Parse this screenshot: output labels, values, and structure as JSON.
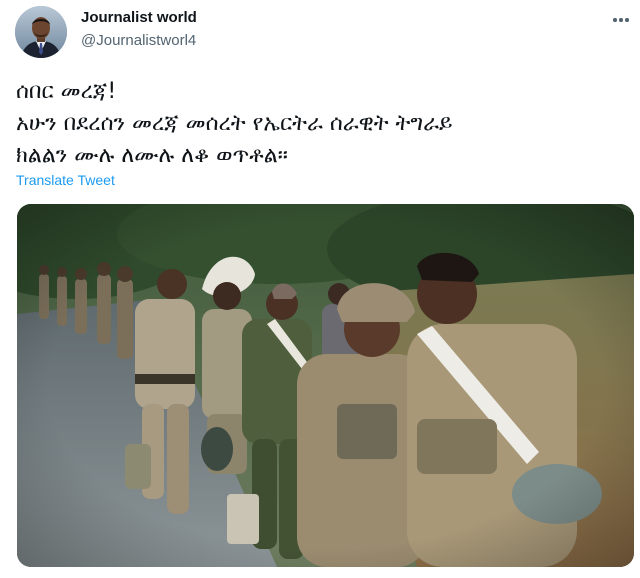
{
  "author": {
    "display_name": "Journalist world",
    "handle": "@Journalistworl4",
    "avatar_icon": "person-in-suit-avatar"
  },
  "more_menu_icon": "ellipsis-icon",
  "tweet": {
    "lines": [
      "ሰበር መረጃ!",
      "አሁን በደረሰን መረጃ መሰረት የኤርትራ ሰራዊት ትግራይ",
      "ክልልን ሙሉ ለሙሉ ለቆ ወጥቶል።"
    ],
    "translate_label": "Translate Tweet"
  },
  "media": {
    "type": "photo",
    "subject": "soldiers-walking-on-road"
  },
  "colors": {
    "link_blue": "#1d9bf0",
    "secondary_text": "#536471",
    "primary_text": "#0f1419"
  }
}
